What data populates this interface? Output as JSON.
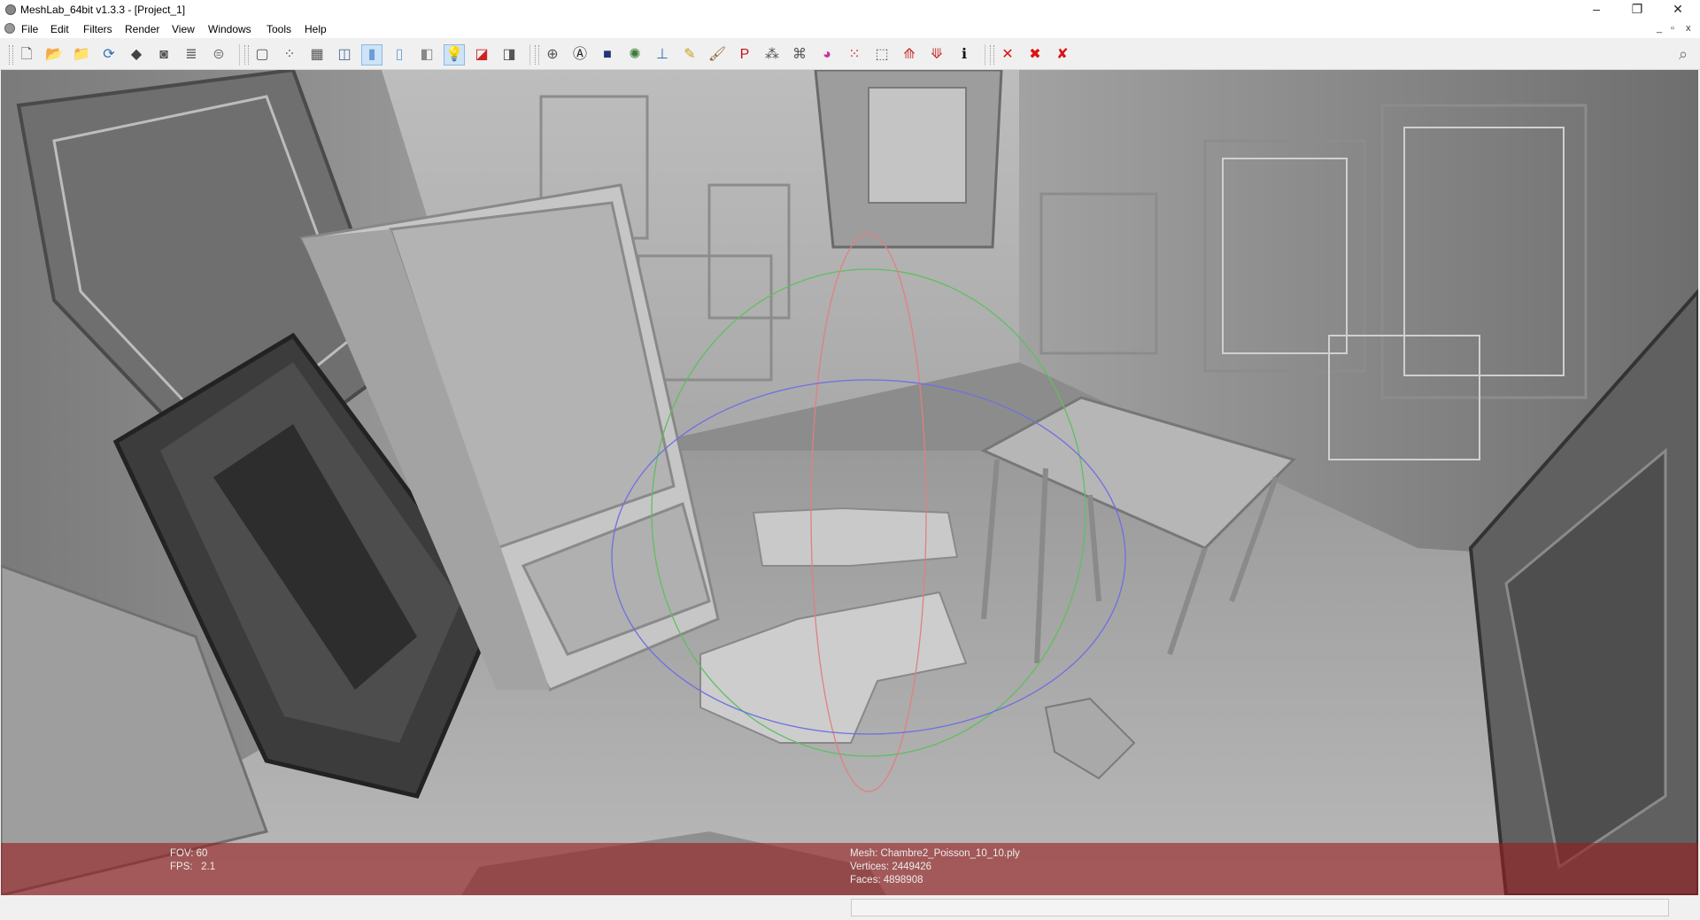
{
  "window": {
    "title": "MeshLab_64bit v1.3.3 - [Project_1]",
    "controls": {
      "minimize": "–",
      "restore": "❐",
      "close": "✕"
    },
    "mdi_controls": {
      "minimize": "_",
      "restore": "▫",
      "close": "x"
    }
  },
  "menu": {
    "items": [
      {
        "label": "File"
      },
      {
        "label": "Edit"
      },
      {
        "label": "Filters"
      },
      {
        "label": "Render"
      },
      {
        "label": "View"
      },
      {
        "label": "Windows"
      },
      {
        "label": "Tools"
      },
      {
        "label": "Help"
      }
    ]
  },
  "toolbar": {
    "groups": [
      {
        "name": "file",
        "buttons": [
          {
            "icon": "new-project-icon",
            "glyph": "🗋",
            "color": "#555555"
          },
          {
            "icon": "open-project-icon",
            "glyph": "📂",
            "color": "#d9a520"
          },
          {
            "icon": "import-mesh-icon",
            "glyph": "📁",
            "color": "#e0b020"
          },
          {
            "icon": "reload-icon",
            "glyph": "⟳",
            "color": "#2d6fb5"
          },
          {
            "icon": "export-mesh-icon",
            "glyph": "◆",
            "color": "#444444"
          },
          {
            "icon": "snapshot-icon",
            "glyph": "◙",
            "color": "#555555"
          },
          {
            "icon": "layer-icon",
            "glyph": "≣",
            "color": "#666666"
          },
          {
            "icon": "server-icon",
            "glyph": "⊜",
            "color": "#777777"
          }
        ]
      },
      {
        "name": "render-mode",
        "buttons": [
          {
            "icon": "bounding-box-icon",
            "glyph": "▢",
            "color": "#555555"
          },
          {
            "icon": "points-icon",
            "glyph": "⁘",
            "color": "#555555"
          },
          {
            "icon": "wireframe-icon",
            "glyph": "▦",
            "color": "#555555"
          },
          {
            "icon": "flat-lines-icon",
            "glyph": "◫",
            "color": "#4a6f99"
          },
          {
            "icon": "flat-icon",
            "glyph": "▮",
            "color": "#6a9ed6",
            "active": true
          },
          {
            "icon": "smooth-icon",
            "glyph": "▯",
            "color": "#6a9ed6"
          },
          {
            "icon": "texture-icon",
            "glyph": "◧",
            "color": "#888888"
          },
          {
            "icon": "light-icon",
            "glyph": "💡",
            "color": "#e8c81a",
            "active": true
          },
          {
            "icon": "double-side-lighting-icon",
            "glyph": "◪",
            "color": "#cc2222"
          },
          {
            "icon": "backface-culling-icon",
            "glyph": "◨",
            "color": "#555555"
          }
        ]
      },
      {
        "name": "edit",
        "buttons": [
          {
            "icon": "trackball-icon",
            "glyph": "⊕",
            "color": "#555555"
          },
          {
            "icon": "align-icon",
            "glyph": "Ⓐ",
            "color": "#222222"
          },
          {
            "icon": "pick-points-icon",
            "glyph": "■",
            "color": "#223377"
          },
          {
            "icon": "select-connected-icon",
            "glyph": "✺",
            "color": "#3a7a3a"
          },
          {
            "icon": "axis-icon",
            "glyph": "⊥",
            "color": "#2d6fb5"
          },
          {
            "icon": "paint-icon",
            "glyph": "✎",
            "color": "#c8a020"
          },
          {
            "icon": "brush-icon",
            "glyph": "🖌",
            "color": "#8a5a2a"
          },
          {
            "icon": "measure-icon",
            "glyph": "P",
            "color": "#cc1111"
          },
          {
            "icon": "select-vertices-icon",
            "glyph": "⁂",
            "color": "#555555"
          },
          {
            "icon": "select-faces-icon",
            "glyph": "⌘",
            "color": "#555555"
          },
          {
            "icon": "texture-paint-icon",
            "glyph": "◕",
            "color": "#cc3399"
          },
          {
            "icon": "reference-icon",
            "glyph": "⁙",
            "color": "#cc3333"
          },
          {
            "icon": "select-area-icon",
            "glyph": "⬚",
            "color": "#555555"
          },
          {
            "icon": "mesh-select-icon",
            "glyph": "⟰",
            "color": "#cc3333"
          },
          {
            "icon": "mesh-deselect-icon",
            "glyph": "⟱",
            "color": "#cc3333"
          },
          {
            "icon": "info-icon",
            "glyph": "ℹ",
            "color": "#111111"
          }
        ]
      },
      {
        "name": "delete",
        "buttons": [
          {
            "icon": "delete-vertices-icon",
            "glyph": "✕",
            "color": "#dd1111"
          },
          {
            "icon": "delete-faces-icon",
            "glyph": "✖",
            "color": "#dd1111"
          },
          {
            "icon": "delete-faces-vertices-icon",
            "glyph": "✘",
            "color": "#dd1111"
          }
        ]
      }
    ]
  },
  "viewport": {
    "fov_label": "FOV:",
    "fov_value": "60",
    "fps_label": "FPS:",
    "fps_value": "2.1",
    "mesh_label": "Mesh:",
    "mesh_value": "Chambre2_Poisson_10_10.ply",
    "vertices_label": "Vertices:",
    "vertices_value": "2449426",
    "faces_label": "Faces:",
    "faces_value": "4898908"
  },
  "statusbar": {
    "message": ""
  }
}
